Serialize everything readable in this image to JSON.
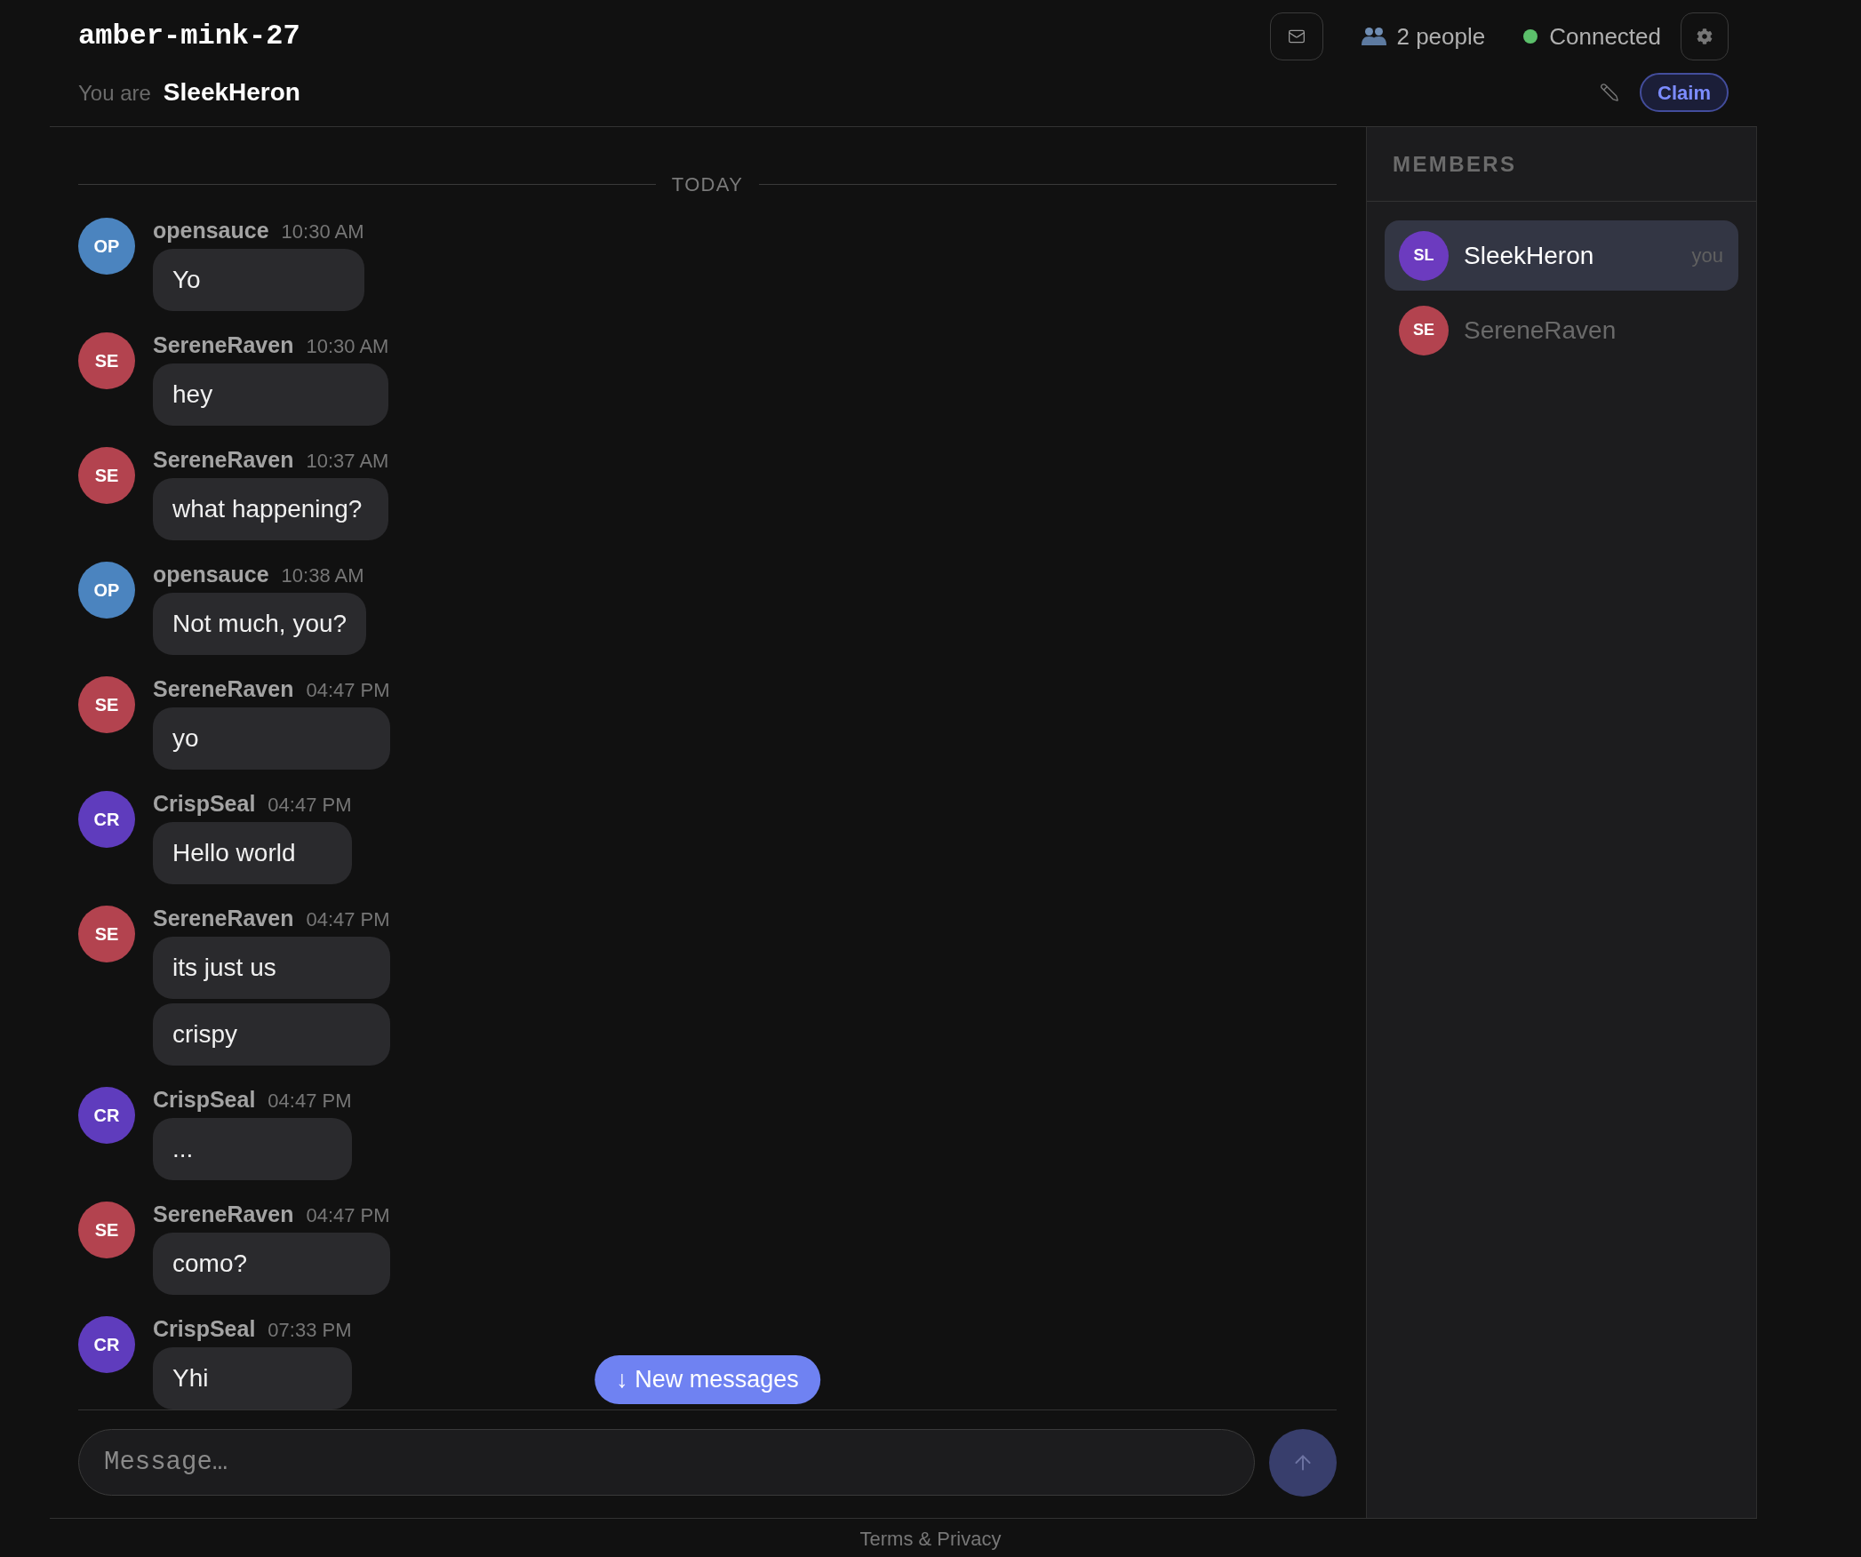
{
  "room": {
    "title": "amber-mink-27",
    "identity_label": "You are",
    "identity_name": "SleekHeron"
  },
  "header": {
    "people": "2 people",
    "status": {
      "label": "Connected",
      "connected": true
    },
    "claim": "Claim"
  },
  "chat": {
    "day_divider": "TODAY",
    "messages": [
      {
        "author": "opensauce",
        "time": "10:30 AM",
        "initials": "OP",
        "color": "#4b84bf",
        "bubbles": [
          "Yo"
        ]
      },
      {
        "author": "SereneRaven",
        "time": "10:30 AM",
        "initials": "SE",
        "color": "#b3434f",
        "bubbles": [
          "hey"
        ]
      },
      {
        "author": "SereneRaven",
        "time": "10:37 AM",
        "initials": "SE",
        "color": "#b3434f",
        "bubbles": [
          "what happening?"
        ]
      },
      {
        "author": "opensauce",
        "time": "10:38 AM",
        "initials": "OP",
        "color": "#4b84bf",
        "bubbles": [
          "Not much, you?"
        ]
      },
      {
        "author": "SereneRaven",
        "time": "04:47 PM",
        "initials": "SE",
        "color": "#b3434f",
        "bubbles": [
          "yo"
        ]
      },
      {
        "author": "CrispSeal",
        "time": "04:47 PM",
        "initials": "CR",
        "color": "#5f3cbd",
        "bubbles": [
          "Hello world"
        ]
      },
      {
        "author": "SereneRaven",
        "time": "04:47 PM",
        "initials": "SE",
        "color": "#b3434f",
        "bubbles": [
          "its just us",
          "crispy"
        ]
      },
      {
        "author": "CrispSeal",
        "time": "04:47 PM",
        "initials": "CR",
        "color": "#5f3cbd",
        "bubbles": [
          "..."
        ]
      },
      {
        "author": "SereneRaven",
        "time": "04:47 PM",
        "initials": "SE",
        "color": "#b3434f",
        "bubbles": [
          "como?"
        ]
      },
      {
        "author": "CrispSeal",
        "time": "07:33 PM",
        "initials": "CR",
        "color": "#5f3cbd",
        "bubbles": [
          "Yhi"
        ]
      }
    ],
    "new_messages": "↓ New messages"
  },
  "composer": {
    "placeholder": "Message…",
    "send_disabled": true
  },
  "members": {
    "title": "MEMBERS",
    "items": [
      {
        "initials": "SL",
        "color": "#6c3bbf",
        "name": "SleekHeron",
        "tag": "you",
        "selected": true
      },
      {
        "initials": "SE",
        "color": "#b3434f",
        "name": "SereneRaven",
        "selected": false
      }
    ]
  },
  "footer": {
    "link": "Terms & Privacy"
  }
}
